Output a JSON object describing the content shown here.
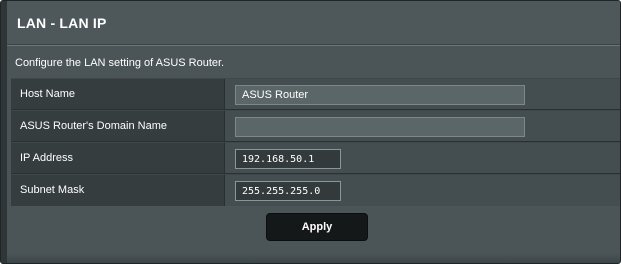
{
  "page": {
    "title": "LAN - LAN IP",
    "description": "Configure the LAN setting of ASUS Router."
  },
  "settings": {
    "host_name": {
      "label": "Host Name",
      "value": "ASUS Router"
    },
    "domain_name": {
      "label": "ASUS Router's Domain Name",
      "value": ""
    },
    "ip_address": {
      "label": "IP Address",
      "value": "192.168.50.1"
    },
    "subnet_mask": {
      "label": "Subnet Mask",
      "value": "255.255.255.0"
    }
  },
  "actions": {
    "apply_label": "Apply"
  },
  "colors": {
    "panel_bg": "#4b5558",
    "label_cell_bg": "#363d3f",
    "value_cell_bg": "#444d50",
    "button_bg": "#151819"
  }
}
